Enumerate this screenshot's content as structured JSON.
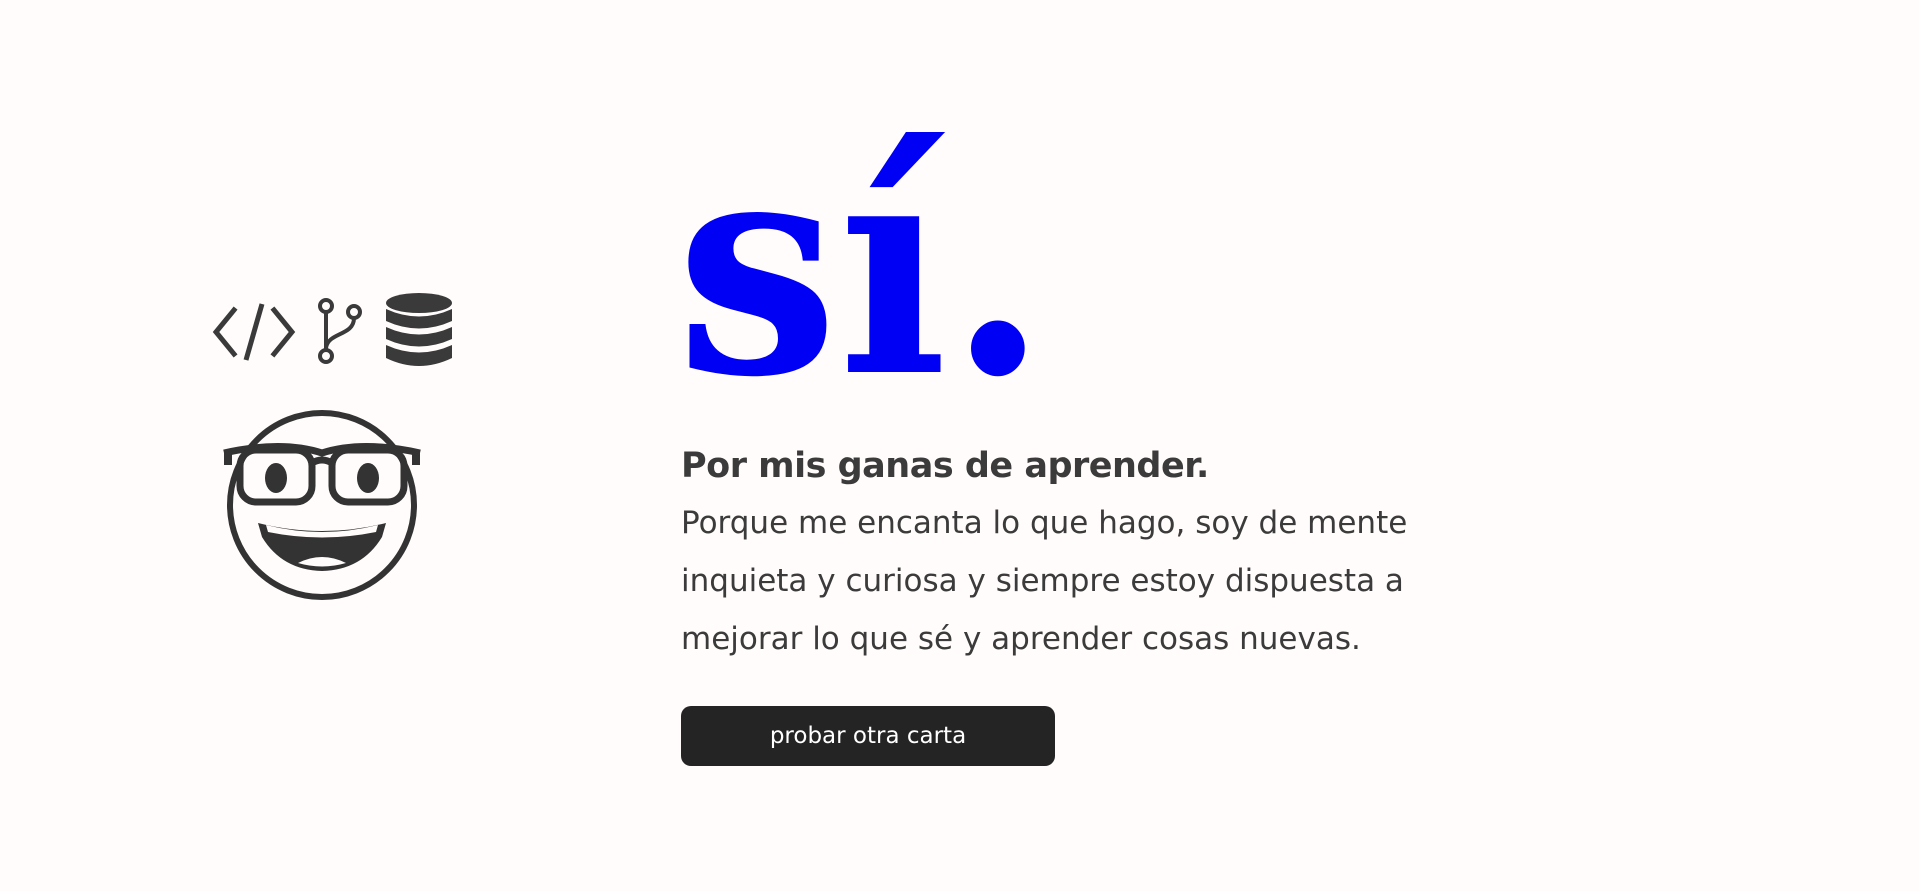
{
  "icons": {
    "code": "code-brackets-icon",
    "branch": "git-branch-icon",
    "database": "database-icon",
    "emoji": "nerd-face-emoji-icon"
  },
  "card": {
    "big_word": "sí.",
    "headline": "Por mis ganas de aprender.",
    "body": "Porque me encanta lo que hago, soy de mente inquieta y curiosa y siempre estoy dispuesta a mejorar lo que sé y aprender cosas nuevas.",
    "button_label": "probar otra carta"
  },
  "colors": {
    "background": "#fffcfb",
    "accent": "#0000f5",
    "text": "#3b3b3b",
    "button": "#242424"
  }
}
